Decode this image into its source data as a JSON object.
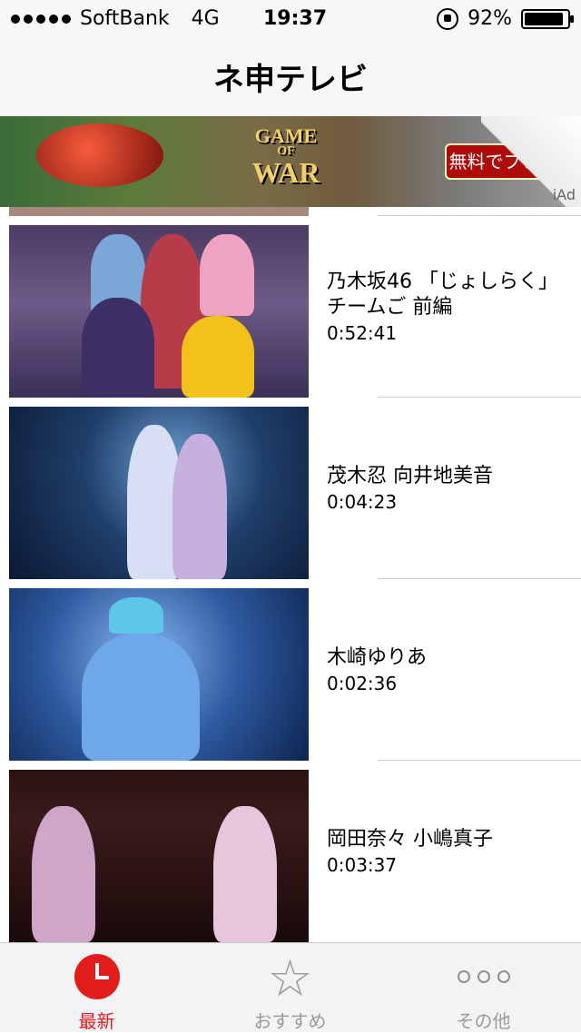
{
  "status_bar": {
    "carrier": "SoftBank",
    "network": "4G",
    "time": "19:37",
    "battery_percent": "92%",
    "battery_level": 0.92
  },
  "nav": {
    "title": "ネ申テレビ"
  },
  "ad": {
    "game_logo_top": "GAME",
    "game_logo_mid": "OF",
    "game_logo_bottom": "WAR",
    "play_button": "無料でプレイ",
    "network_label": "iAd"
  },
  "videos": [
    {
      "title": "乃木坂46 「じょしらく」チームご 前編",
      "duration": "0:52:41"
    },
    {
      "title": "茂木忍 向井地美音",
      "duration": "0:04:23"
    },
    {
      "title": "木崎ゆりあ",
      "duration": "0:02:36"
    },
    {
      "title": "岡田奈々 小嶋真子",
      "duration": "0:03:37"
    }
  ],
  "tabs": [
    {
      "label": "最新",
      "icon": "clock-icon",
      "active": true,
      "color": "#e21b1b"
    },
    {
      "label": "おすすめ",
      "icon": "star-icon",
      "active": false,
      "color": "#9b9b9b"
    },
    {
      "label": "その他",
      "icon": "more-icon",
      "active": false,
      "color": "#9b9b9b"
    }
  ]
}
